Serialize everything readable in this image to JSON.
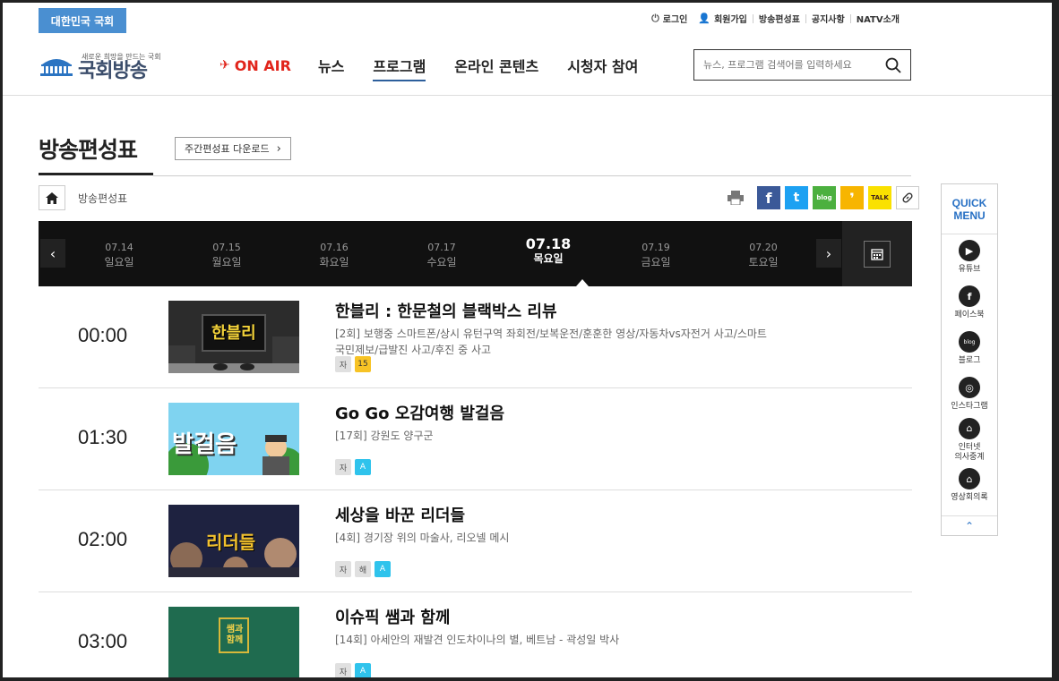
{
  "top_badge": "대한민국 국회",
  "util_links": [
    {
      "icon": "power-icon",
      "label": "로그인"
    },
    {
      "icon": "user-plus-icon",
      "label": "회원가입"
    },
    {
      "icon": "",
      "label": "방송편성표"
    },
    {
      "icon": "",
      "label": "공지사항"
    },
    {
      "icon": "",
      "label": "NATV소개"
    }
  ],
  "logo": {
    "tagline": "새로운 희망을 만드는 국회",
    "name": "국회방송"
  },
  "nav": {
    "onair": "ON AIR",
    "items": [
      "뉴스",
      "프로그램",
      "온라인 콘텐츠",
      "시청자 참여"
    ],
    "active_index": 1
  },
  "search": {
    "placeholder": "뉴스, 프로그램 검색어를 입력하세요"
  },
  "page": {
    "title": "방송편성표",
    "download": "주간편성표 다운로드"
  },
  "breadcrumb": {
    "current": "방송편성표"
  },
  "share": [
    {
      "name": "facebook",
      "label": "f",
      "color": "#3b5998"
    },
    {
      "name": "twitter",
      "label": "t",
      "color": "#1da1f2"
    },
    {
      "name": "blog",
      "label": "blog",
      "color": "#4cb03f"
    },
    {
      "name": "kakaostory",
      "label": "❜",
      "color": "#f7b500"
    },
    {
      "name": "kakaotalk",
      "label": "TALK",
      "color": "#fae100"
    }
  ],
  "dates": [
    {
      "date": "07.14",
      "weekday": "일요일"
    },
    {
      "date": "07.15",
      "weekday": "월요일"
    },
    {
      "date": "07.16",
      "weekday": "화요일"
    },
    {
      "date": "07.17",
      "weekday": "수요일"
    },
    {
      "date": "07.18",
      "weekday": "목요일"
    },
    {
      "date": "07.19",
      "weekday": "금요일"
    },
    {
      "date": "07.20",
      "weekday": "토요일"
    }
  ],
  "active_date_index": 4,
  "programs": [
    {
      "time": "00:00",
      "title": "한블리 : 한문철의 블랙박스 리뷰",
      "desc": "[2회] 보행중 스마트폰/상시 유턴구역 좌회전/보복운전/훈훈한 영상/자동차vs자전거 사고/스마트 국민제보/급발진 사고/후진 중 사고",
      "tags": [
        {
          "label": "자",
          "style": "gray"
        },
        {
          "label": "15",
          "style": "yellow"
        }
      ]
    },
    {
      "time": "01:30",
      "title": "Go Go 오감여행 발걸음",
      "desc": "[17회] 강원도 양구군",
      "tags": [
        {
          "label": "자",
          "style": "gray"
        },
        {
          "label": "A",
          "style": "cyan"
        }
      ]
    },
    {
      "time": "02:00",
      "title": "세상을 바꾼 리더들",
      "desc": "[4회] 경기장 위의 마술사, 리오넬 메시",
      "tags": [
        {
          "label": "자",
          "style": "gray"
        },
        {
          "label": "해",
          "style": "gray"
        },
        {
          "label": "A",
          "style": "cyan"
        }
      ]
    },
    {
      "time": "03:00",
      "title": "이슈픽 쌤과 함께",
      "desc": "[14회] 아세안의 재발견 인도차이나의 별, 베트남 - 곽성일 박사",
      "tags": [
        {
          "label": "자",
          "style": "gray"
        },
        {
          "label": "A",
          "style": "cyan"
        }
      ]
    }
  ],
  "thumb_text": {
    "hanbli": "한블리",
    "balgeoreum": "발걸음",
    "leaders": "리더들",
    "ssaem": "쌤과 함께"
  },
  "quick_menu": {
    "title_line1": "QUICK",
    "title_line2": "MENU",
    "items": [
      {
        "label": "유튜브",
        "icon": "youtube-icon"
      },
      {
        "label": "페이스북",
        "icon": "facebook-icon"
      },
      {
        "label": "블로그",
        "icon": "blog-icon"
      },
      {
        "label": "인스타그램",
        "icon": "instagram-icon"
      },
      {
        "label": "인터넷\n의사중계",
        "icon": "assembly-icon"
      },
      {
        "label": "영상회의록",
        "icon": "assembly-icon"
      }
    ]
  }
}
